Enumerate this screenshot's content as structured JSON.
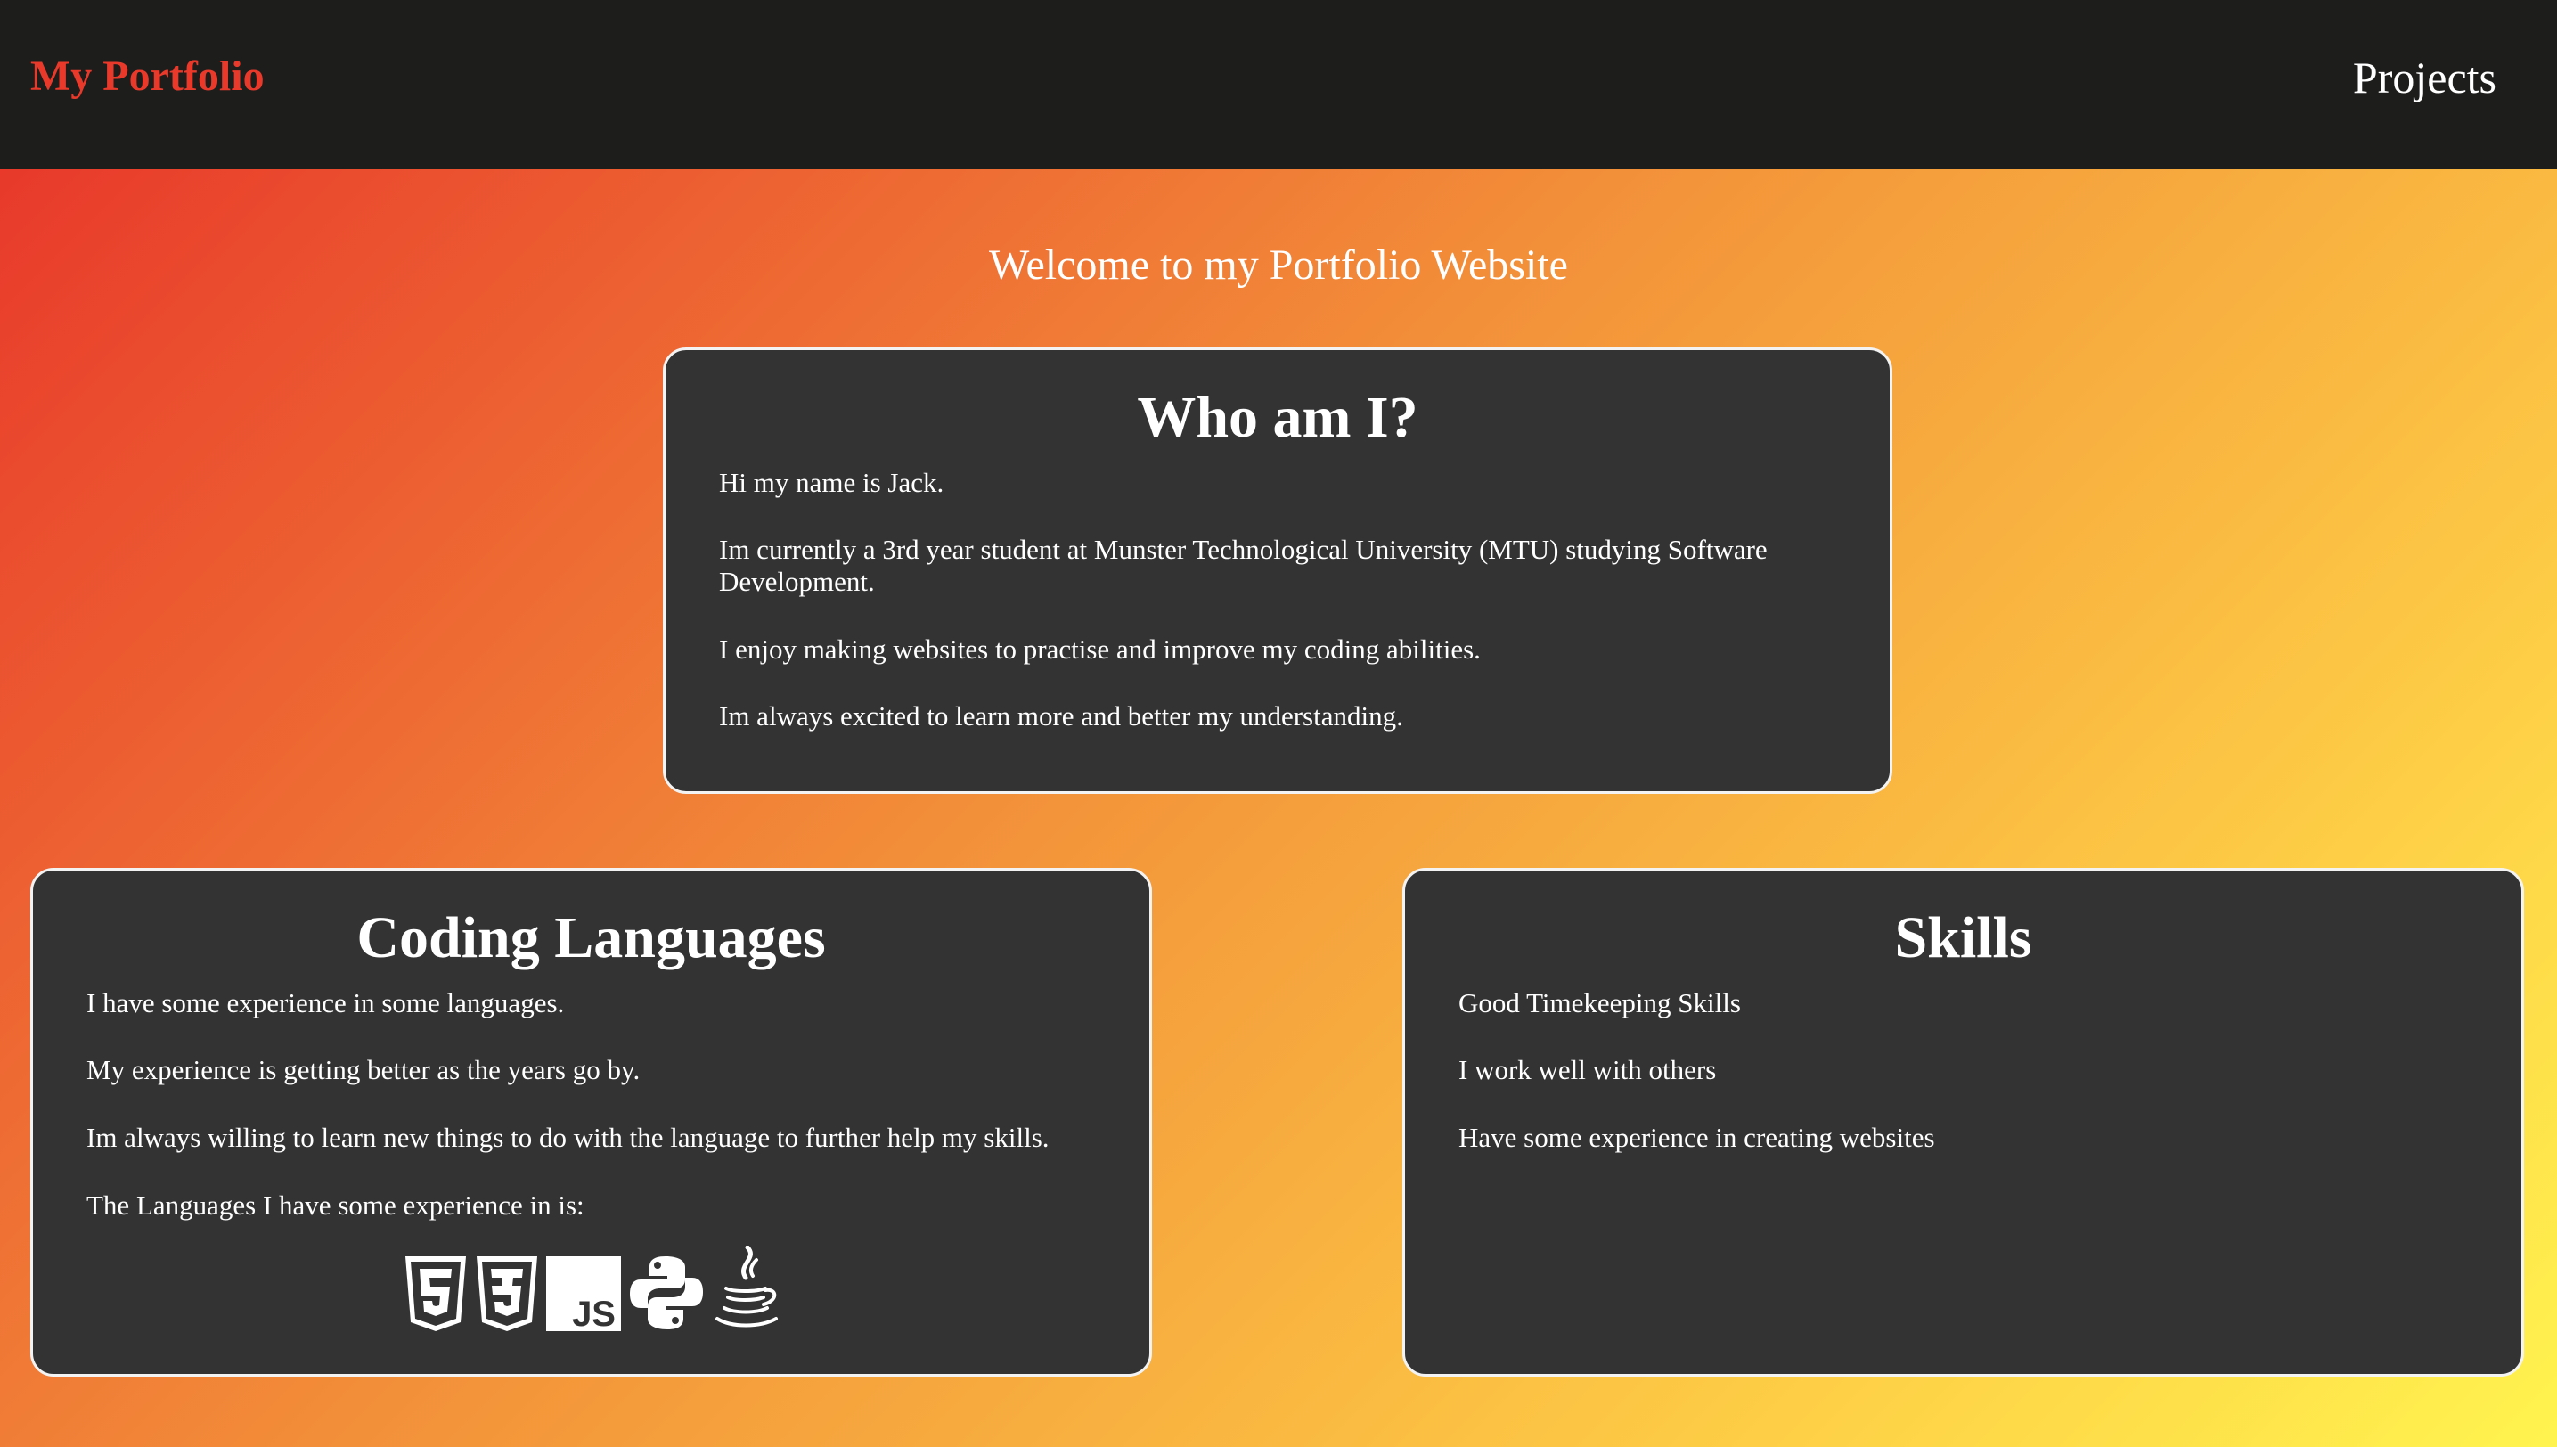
{
  "header": {
    "brand": "My Portfolio",
    "nav_projects": "Projects"
  },
  "main": {
    "welcome": "Welcome to my Portfolio Website",
    "who": {
      "title": "Who am I?",
      "paragraphs": [
        "Hi my name is Jack.",
        "Im currently a 3rd year student at Munster Technological University (MTU) studying Software Development.",
        "I enjoy making websites to practise and improve my coding abilities.",
        "Im always excited to learn more and better my understanding."
      ]
    },
    "coding": {
      "title": "Coding Languages",
      "paragraphs": [
        "I have some experience in some languages.",
        "My experience is getting better as the years go by.",
        "Im always willing to learn new things to do with the language to further help my skills.",
        "The Languages I have some experience in is:"
      ],
      "icons": [
        "html5-icon",
        "css3-icon",
        "javascript-icon",
        "python-icon",
        "java-icon"
      ]
    },
    "skills": {
      "title": "Skills",
      "paragraphs": [
        "Good Timekeeping Skills",
        "I work well with others",
        "Have some experience in creating websites"
      ]
    }
  },
  "colors": {
    "nav_bg": "#1d1e1c",
    "brand": "#e8392b",
    "card_bg": "#333333",
    "gradient_start": "#e8392b",
    "gradient_end": "#fff44f"
  }
}
